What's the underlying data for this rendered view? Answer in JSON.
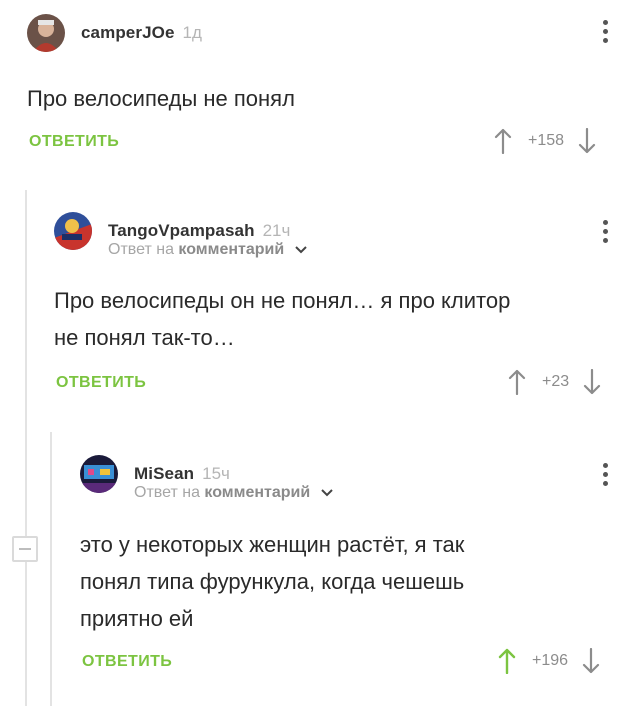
{
  "comments": [
    {
      "username": "camperJOe",
      "time": "1д",
      "text": "Про велосипеды не понял",
      "reply_label": "ОТВЕТИТЬ",
      "score": "+158"
    },
    {
      "username": "TangoVpampasah",
      "time": "21ч",
      "reply_prefix": "Ответ на",
      "reply_target": "комментарий",
      "text_lines": [
        "Про велосипеды он не понял… я про клитор",
        "не понял так-то…"
      ],
      "reply_label": "ОТВЕТИТЬ",
      "score": "+23"
    },
    {
      "username": "MiSean",
      "time": "15ч",
      "reply_prefix": "Ответ на",
      "reply_target": "комментарий",
      "text_lines": [
        "это у некоторых женщин растёт, я так",
        "понял типа фурункула, когда чешешь",
        "приятно ей"
      ],
      "reply_label": "ОТВЕТИТЬ",
      "score": "+196"
    }
  ],
  "colors": {
    "accent": "#7cc441",
    "upvote_active": "#7cc441",
    "muted": "#8c8c8c"
  },
  "icons": [
    "kebab-menu-icon",
    "upvote-arrow-icon",
    "downvote-arrow-icon",
    "chevron-down-icon",
    "collapse-thread-icon"
  ]
}
